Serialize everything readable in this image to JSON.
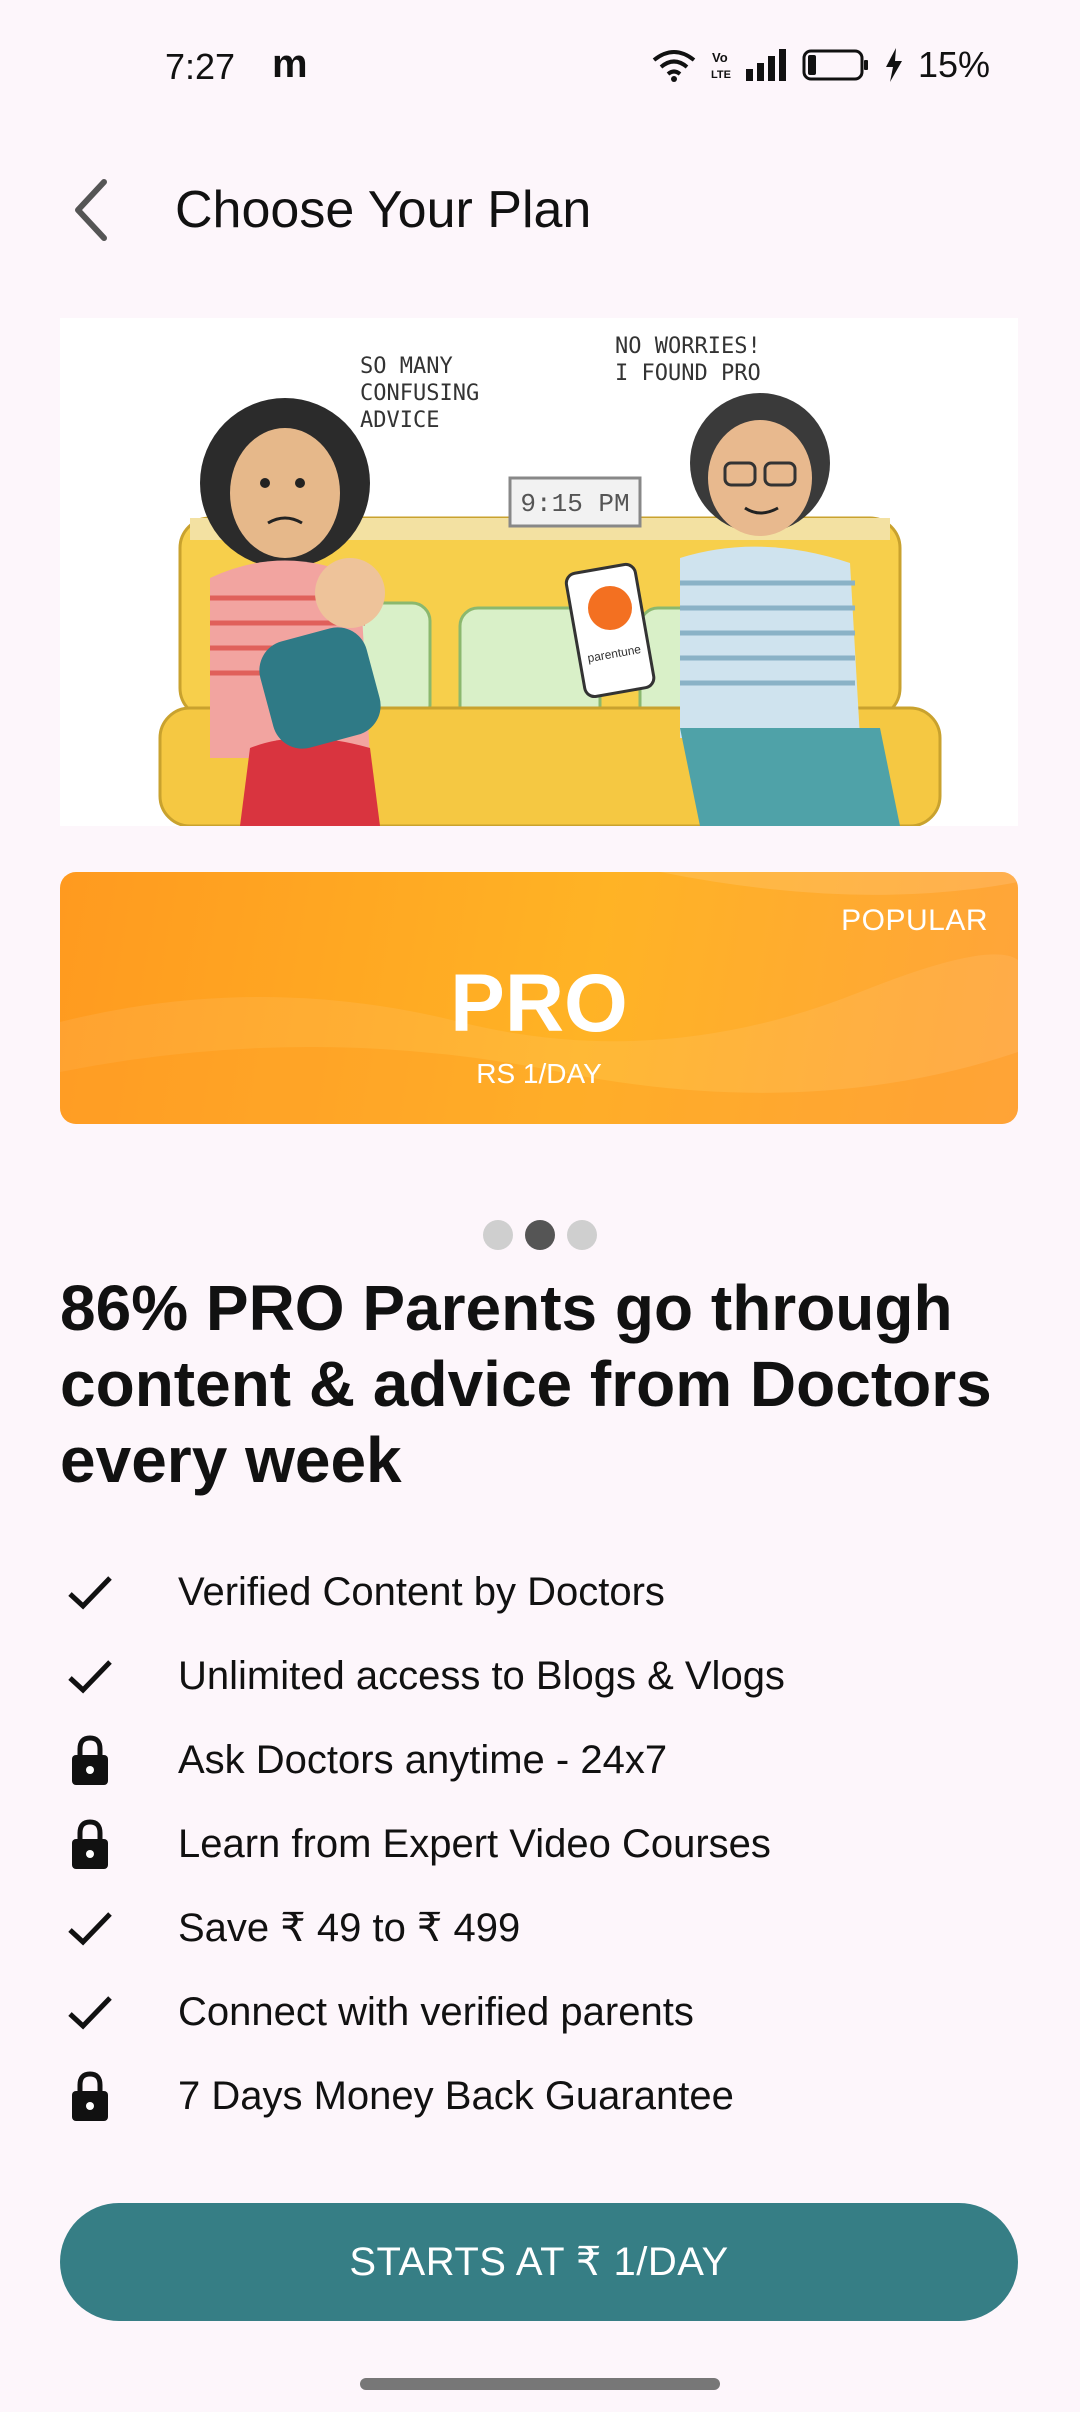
{
  "status_bar": {
    "time": "7:27",
    "app_indicator": "m",
    "battery_text": "15%",
    "icons": [
      "wifi-icon",
      "volte-icon",
      "signal-icon",
      "battery-icon",
      "charging-icon"
    ]
  },
  "header": {
    "back_icon": "chevron-left-icon",
    "title": "Choose Your Plan"
  },
  "illustration": {
    "speech_left": [
      "SO MANY",
      "CONFUSING",
      "ADVICE"
    ],
    "speech_right": [
      "NO WORRIES!",
      "I FOUND PRO"
    ],
    "clock": "9:15 PM",
    "app_brand": "parentune"
  },
  "plan_card": {
    "badge": "POPULAR",
    "name": "PRO",
    "price": "RS 1/DAY"
  },
  "carousel": {
    "pages": 3,
    "active_index": 1
  },
  "headline": "86% PRO Parents go through content & advice from Doctors every week",
  "features": [
    {
      "icon": "check-icon",
      "label": "Verified Content by Doctors"
    },
    {
      "icon": "check-icon",
      "label": "Unlimited access to Blogs & Vlogs"
    },
    {
      "icon": "lock-icon",
      "label": "Ask Doctors anytime - 24x7"
    },
    {
      "icon": "lock-icon",
      "label": "Learn from Expert Video Courses"
    },
    {
      "icon": "check-icon",
      "label": "Save ₹ 49 to ₹ 499"
    },
    {
      "icon": "check-icon",
      "label": "Connect with verified parents"
    },
    {
      "icon": "lock-icon",
      "label": "7 Days Money Back Guarantee"
    }
  ],
  "cta": {
    "label": "STARTS AT ₹ 1/DAY"
  },
  "colors": {
    "background": "#fdf6fb",
    "card_orange": "#ffa726",
    "cta_teal": "#367e85",
    "dot_active": "#555555",
    "dot_inactive": "#cfcfcf"
  }
}
